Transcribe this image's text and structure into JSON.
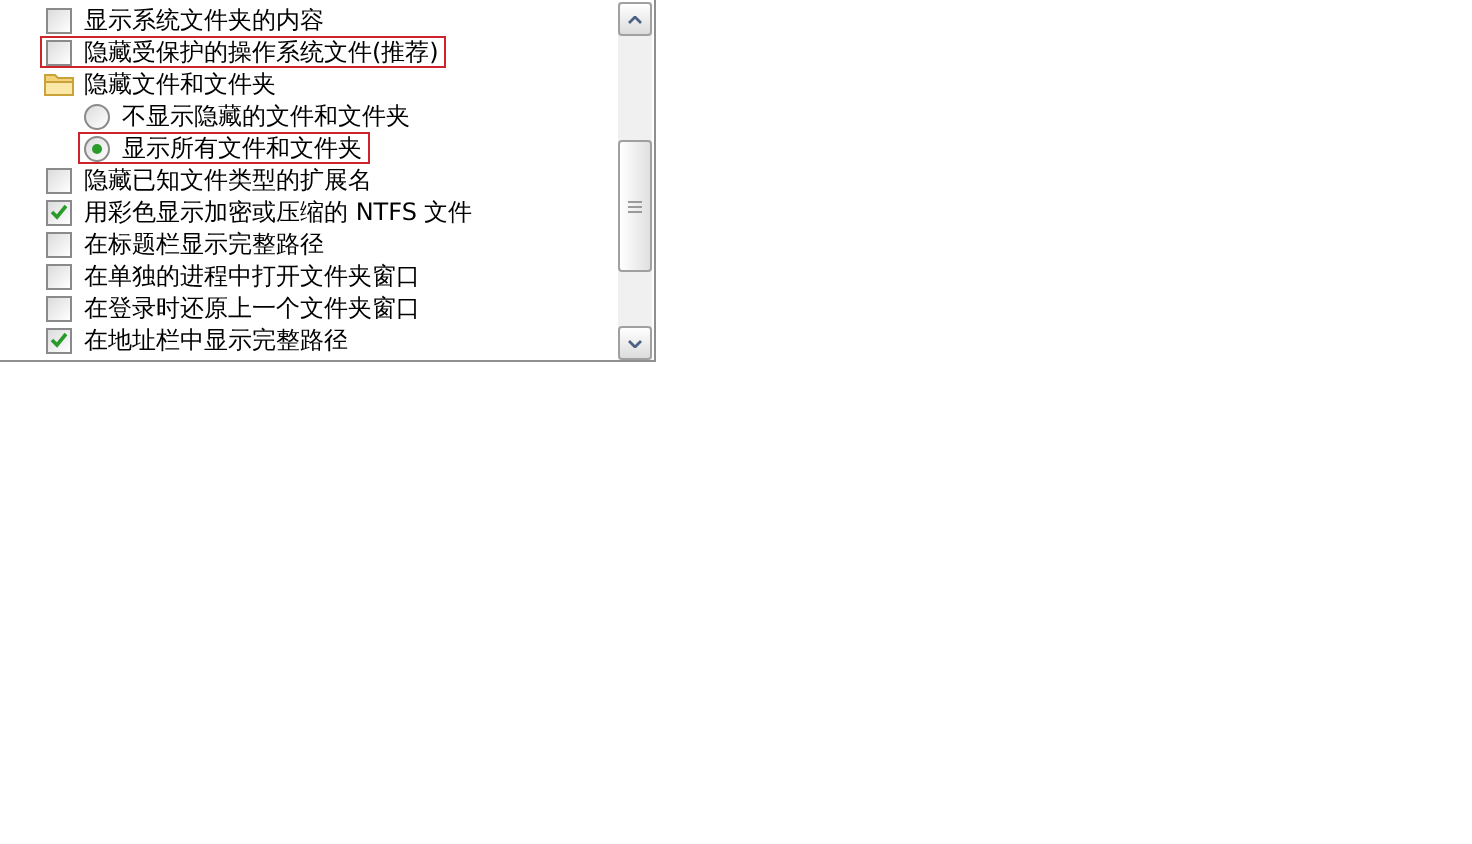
{
  "options": [
    {
      "kind": "checkbox",
      "label": "显示系统文件夹的内容",
      "checked": false,
      "highlighted": false
    },
    {
      "kind": "checkbox",
      "label": "隐藏受保护的操作系统文件(推荐)",
      "checked": false,
      "highlighted": true
    },
    {
      "kind": "folder",
      "label": "隐藏文件和文件夹",
      "children": [
        {
          "kind": "radio",
          "label": "不显示隐藏的文件和文件夹",
          "selected": false,
          "highlighted": false
        },
        {
          "kind": "radio",
          "label": "显示所有文件和文件夹",
          "selected": true,
          "highlighted": true
        }
      ]
    },
    {
      "kind": "checkbox",
      "label": "隐藏已知文件类型的扩展名",
      "checked": false,
      "highlighted": false
    },
    {
      "kind": "checkbox",
      "label": "用彩色显示加密或压缩的 NTFS 文件",
      "checked": true,
      "highlighted": false
    },
    {
      "kind": "checkbox",
      "label": "在标题栏显示完整路径",
      "checked": false,
      "highlighted": false
    },
    {
      "kind": "checkbox",
      "label": "在单独的进程中打开文件夹窗口",
      "checked": false,
      "highlighted": false
    },
    {
      "kind": "checkbox",
      "label": "在登录时还原上一个文件夹窗口",
      "checked": false,
      "highlighted": false
    },
    {
      "kind": "checkbox",
      "label": "在地址栏中显示完整路径",
      "checked": true,
      "highlighted": false
    }
  ]
}
